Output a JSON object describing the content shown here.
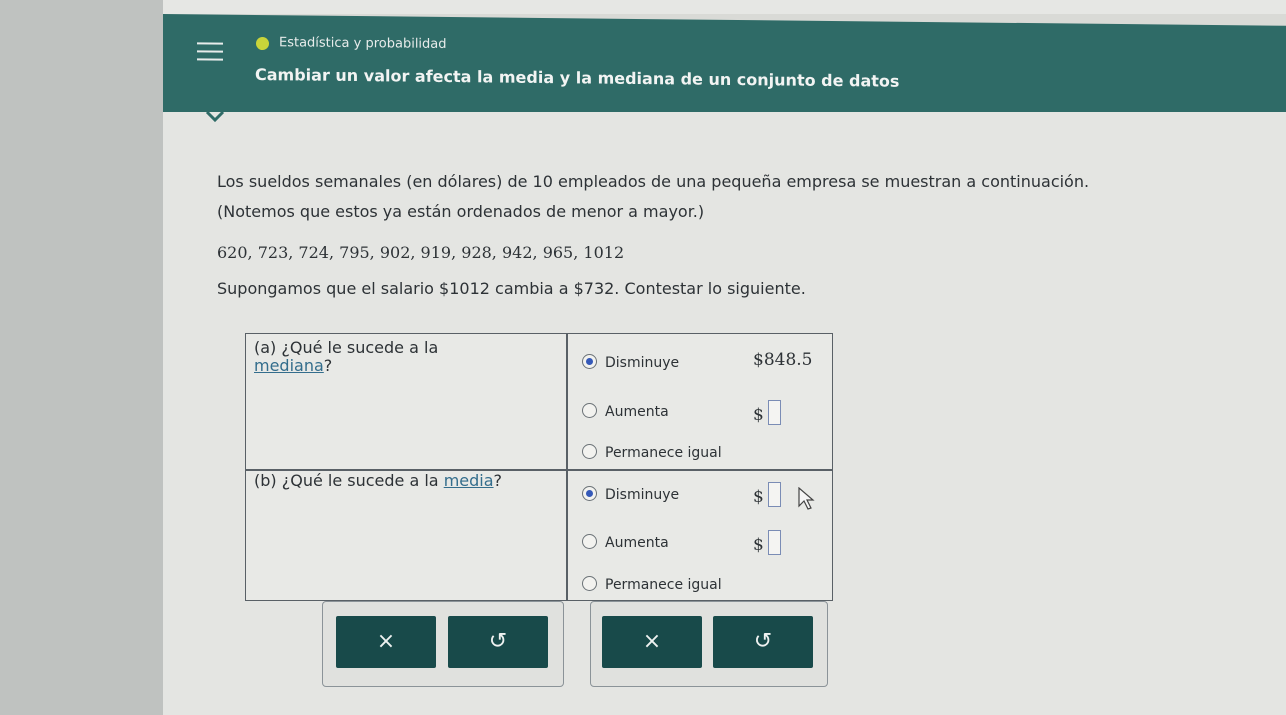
{
  "header": {
    "subject": "Estadística y probabilidad",
    "topic": "Cambiar un valor afecta la media y la mediana de un conjunto de datos"
  },
  "problem": {
    "intro_line1": "Los sueldos semanales (en dólares) de 10 empleados de una pequeña empresa se muestran a continuación.",
    "intro_line2": "(Notemos que estos ya están ordenados de menor a mayor.)",
    "data_list": "620, 723, 724, 795, 902, 919, 928, 942, 965, 1012",
    "instruction": "Supongamos que el salario $1012 cambia a $732. Contestar lo siguiente."
  },
  "question_a": {
    "prefix": "(a)  ¿Qué le sucede a la",
    "link": "mediana",
    "suffix": "?",
    "options": [
      "Disminuye",
      "Aumenta",
      "Permanece igual"
    ],
    "selected_index": 0,
    "amount_decrease": "$848.5",
    "currency": "$"
  },
  "question_b": {
    "prefix": "(b)  ¿Qué le sucede a la",
    "link": "media",
    "suffix": "?",
    "options": [
      "Disminuye",
      "Aumenta",
      "Permanece igual"
    ],
    "selected_index": 0,
    "currency": "$"
  },
  "buttons": {
    "clear_symbol": "×",
    "undo_symbol": "↺"
  },
  "colors": {
    "header_bg": "#2f6b67",
    "button_bg": "#184a4a",
    "radio_selected": "#3559b8",
    "link": "#336d8c"
  }
}
